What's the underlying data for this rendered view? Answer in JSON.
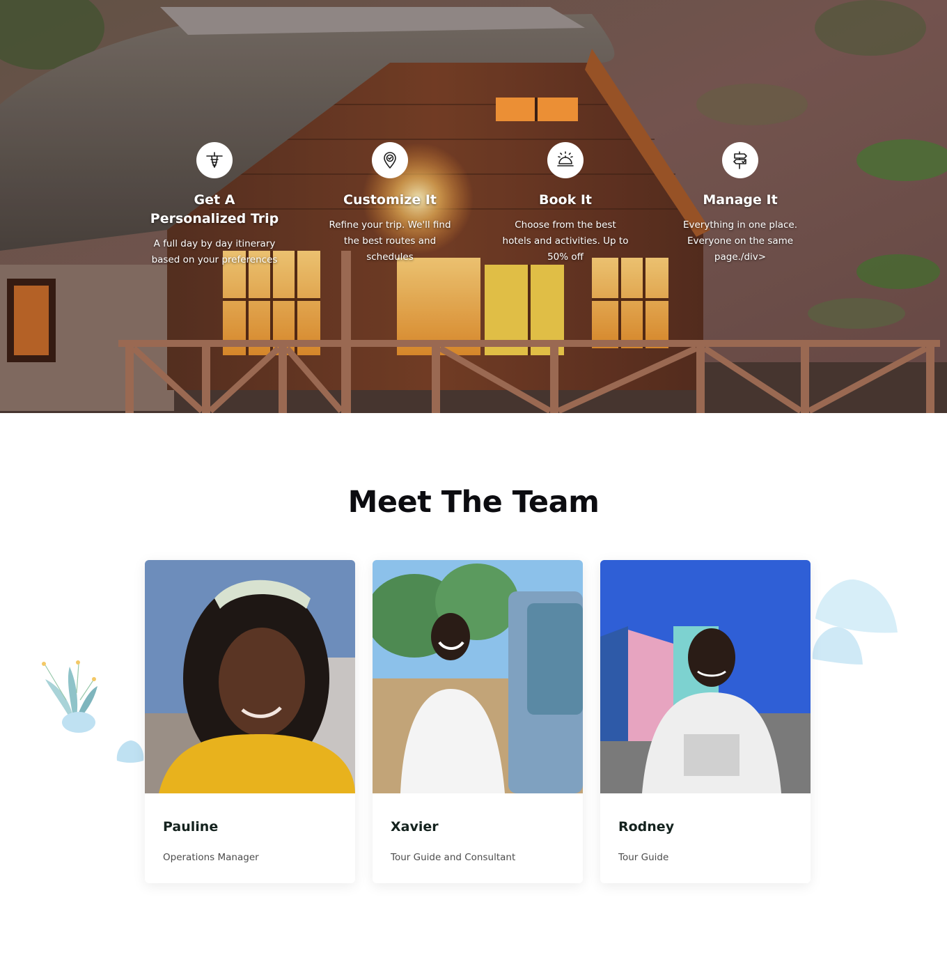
{
  "hero": {
    "steps": [
      {
        "icon": "airplane-icon",
        "title_line1": "Get A",
        "title_line2": "Personalized Trip",
        "description": "A full day by day itinerary based on your preferences"
      },
      {
        "icon": "location-pin-icon",
        "title_line1": "Customize It",
        "title_line2": "",
        "description": "Refine your trip. We'll find the best routes and schedules"
      },
      {
        "icon": "service-bell-icon",
        "title_line1": "Book It",
        "title_line2": "",
        "description": "Choose from the best hotels and activities. Up to 50% off"
      },
      {
        "icon": "signpost-icon",
        "title_line1": "Manage It",
        "title_line2": "",
        "description": "Everything in one place. Everyone on the same page./div>"
      }
    ]
  },
  "team": {
    "heading": "Meet The Team",
    "members": [
      {
        "name": "Pauline",
        "role": "Operations Manager"
      },
      {
        "name": "Xavier",
        "role": "Tour Guide and Consultant"
      },
      {
        "name": "Rodney",
        "role": "Tour Guide"
      }
    ]
  }
}
